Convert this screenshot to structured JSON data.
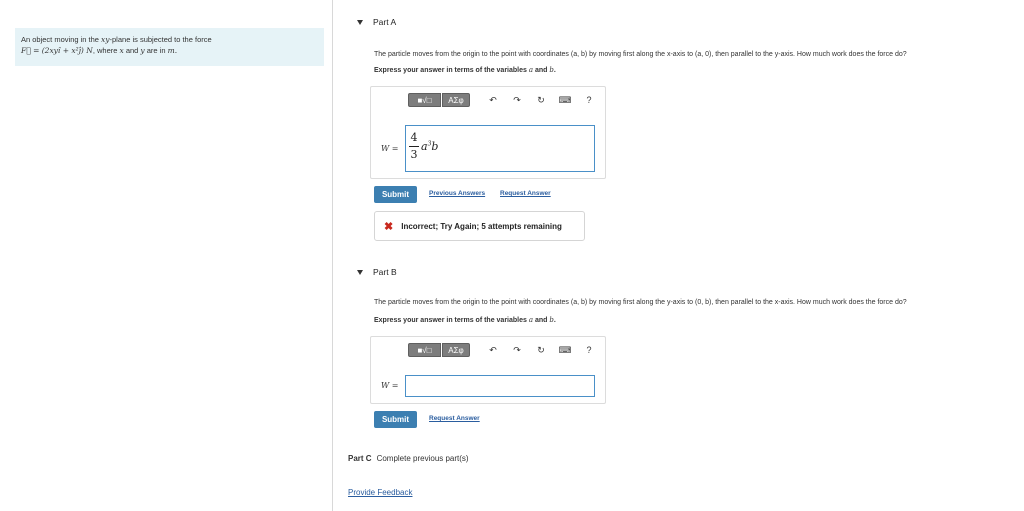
{
  "problem": {
    "text_prefix": "An object moving in the ",
    "text_plane": "xy",
    "text_mid": "-plane is subjected to the force",
    "force_formula": "F⃗ = (2xyî + x²ĵ) N",
    "force_suffix": ", where ",
    "var_x": "x",
    "and": " and ",
    "var_y": "y",
    "are_in": " are in ",
    "unit": "m."
  },
  "part_a": {
    "title": "Part A",
    "question": "The particle moves from the origin to the point with coordinates (a, b) by moving first along the x-axis to (a, 0), then parallel to the y-axis. How much work does the force do?",
    "instruction_prefix": "Express your answer in terms of the variables ",
    "var_a": "a",
    "instruction_and": " and ",
    "var_b": "b",
    "instruction_end": ".",
    "toolbar": {
      "templates": "■√□",
      "symbols": "AΣφ",
      "undo": "↶",
      "redo": "↷",
      "reset": "↻",
      "keyboard": "⌨",
      "help": "?"
    },
    "w_label": "W =",
    "answer_numerator": "4",
    "answer_denominator": "3",
    "answer_tail_var_a": "a",
    "answer_exponent": "3",
    "answer_tail_var_b": "b",
    "submit": "Submit",
    "previous_answers": "Previous Answers",
    "request_answer": "Request Answer",
    "feedback": "Incorrect; Try Again; 5 attempts remaining"
  },
  "part_b": {
    "title": "Part B",
    "question": "The particle moves from the origin to the point with coordinates (a, b) by moving first along the y-axis to (0, b), then parallel to the x-axis. How much work does the force do?",
    "instruction_prefix": "Express your answer in terms of the variables ",
    "var_a": "a",
    "instruction_and": " and ",
    "var_b": "b",
    "instruction_end": ".",
    "toolbar": {
      "templates": "■√□",
      "symbols": "AΣφ",
      "undo": "↶",
      "redo": "↷",
      "reset": "↻",
      "keyboard": "⌨",
      "help": "?"
    },
    "w_label": "W =",
    "submit": "Submit",
    "request_answer": "Request Answer"
  },
  "part_c": {
    "title": "Part C",
    "status": "Complete previous part(s)"
  },
  "provide_feedback": "Provide Feedback",
  "colors": {
    "accent": "#3c7fb1",
    "link": "#2a5d9f",
    "error": "#c8281e",
    "panel": "#e6f3f7"
  }
}
